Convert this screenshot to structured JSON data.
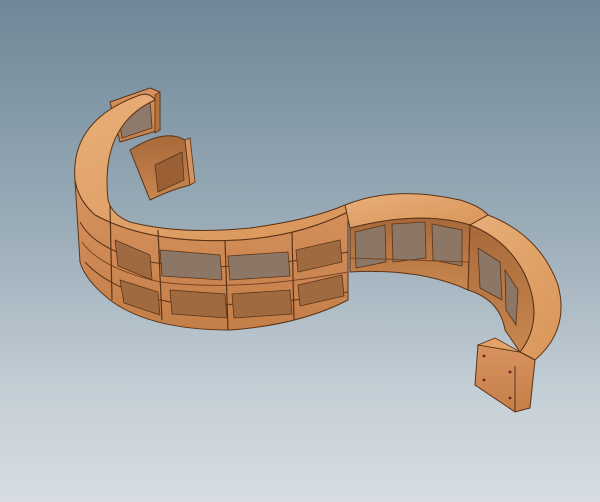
{
  "viewport": {
    "background_top": "#6f8797",
    "background_bottom": "#d7dde2"
  },
  "model": {
    "subject": "s-curve-shelving-unit",
    "wood_top": "#e3a36a",
    "wood_face": "#cf8a55",
    "wood_dark": "#8a5530",
    "edge": "#5a3418"
  }
}
